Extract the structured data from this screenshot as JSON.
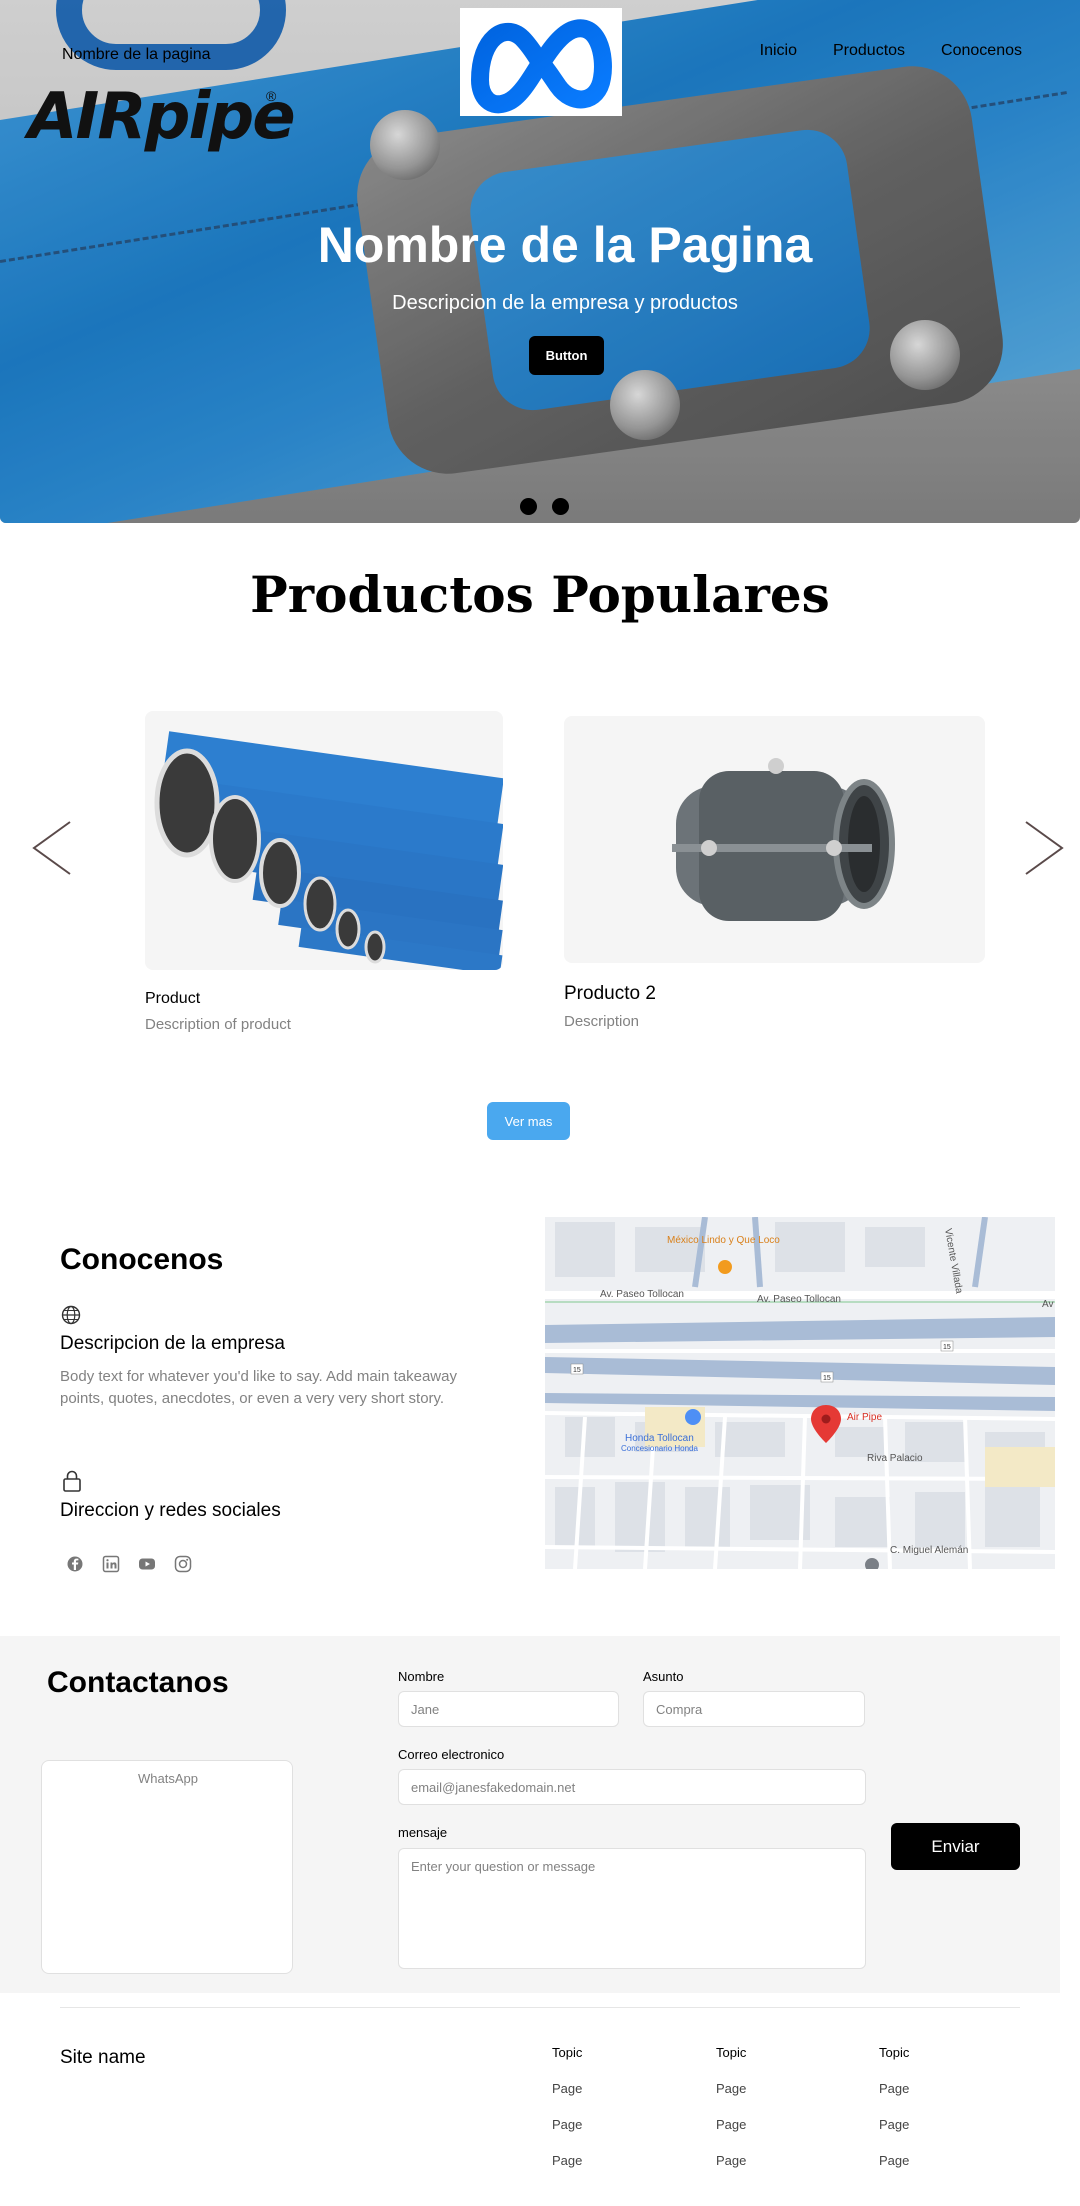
{
  "header": {
    "brand_text": "AIRpipe",
    "brand_reg": "®",
    "site_name": "Nombre de la pagina",
    "nav": [
      "Inicio",
      "Productos",
      "Conocenos"
    ]
  },
  "hero": {
    "title": "Nombre de la Pagina",
    "subtitle": "Descripcion de la empresa y productos",
    "button_label": "Button",
    "slides": 2,
    "active_slide": 1
  },
  "products": {
    "title": "Productos Populares",
    "items": [
      {
        "name": "Product",
        "description": "Description of product"
      },
      {
        "name": "Producto 2",
        "description": "Description"
      }
    ],
    "more_button": "Ver mas"
  },
  "about": {
    "title": "Conocenos",
    "block1_heading": "Descripcion de la empresa",
    "block1_body": "Body text for whatever you'd like to say. Add main takeaway points, quotes, anecdotes, or even a very very short story.",
    "block2_heading": "Direccion y redes sociales",
    "socials": [
      "facebook-icon",
      "linkedin-icon",
      "youtube-icon",
      "instagram-icon"
    ],
    "map_labels": {
      "restaurant": "México Lindo\ny Que Loco",
      "street1": "Av. Paseo Tollocan",
      "street2": "Av. Paseo Tollocan",
      "street3": "Vicente Villada",
      "dealer": "Honda Tollocan",
      "dealer_sub": "Concesionario Honda",
      "pin": "Air Pipe",
      "street4": "Riva Palacio",
      "street5": "C. Miguel Alemán",
      "road_sign": "15",
      "road_sign2": "15",
      "road_sign3": "15",
      "av_short": "Av"
    }
  },
  "contact": {
    "title": "Contactanos",
    "whatsapp_label": "WhatsApp",
    "name_label": "Nombre",
    "name_placeholder": "Jane",
    "subject_label": "Asunto",
    "subject_placeholder": "Compra",
    "email_label": "Correo electronico",
    "email_placeholder": "email@janesfakedomain.net",
    "message_label": "mensaje",
    "message_placeholder": "Enter your question or message",
    "send_label": "Enviar"
  },
  "footer": {
    "site_name": "Site name",
    "columns": [
      {
        "topic": "Topic",
        "pages": [
          "Page",
          "Page",
          "Page"
        ]
      },
      {
        "topic": "Topic",
        "pages": [
          "Page",
          "Page",
          "Page"
        ]
      },
      {
        "topic": "Topic",
        "pages": [
          "Page",
          "Page",
          "Page"
        ]
      }
    ]
  },
  "colors": {
    "accent": "#4aa8ef",
    "pipe_blue": "#1f86d6",
    "meta_blue": "#0668e1",
    "map_pin": "#e53935"
  }
}
